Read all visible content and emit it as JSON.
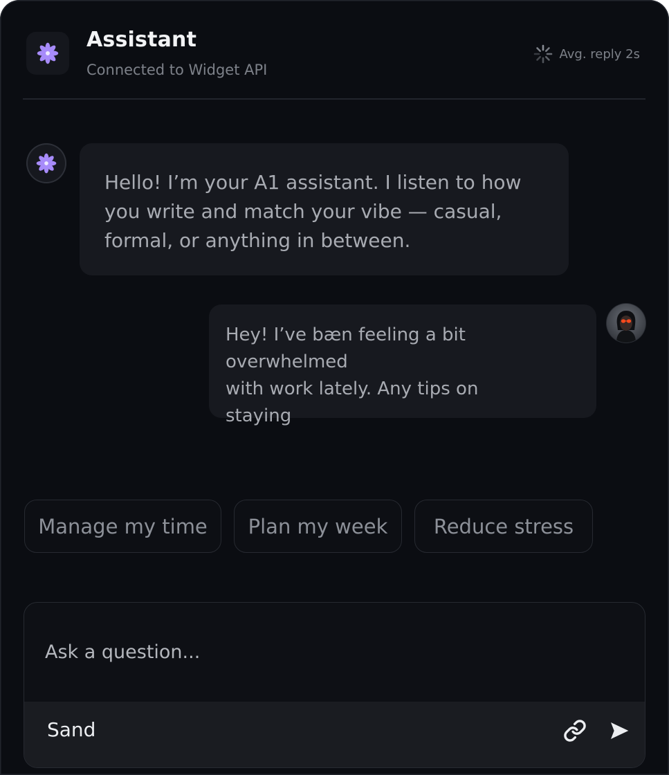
{
  "header": {
    "title": "Assistant",
    "subtitle": "Connected to Widget API",
    "reply_meta": "Avg. reply 2s",
    "logo_icon": "flower-icon",
    "accent": "#a78bfa"
  },
  "messages": [
    {
      "role": "assistant",
      "avatar_icon": "flower-icon",
      "text": "Hello! I’m your A1 assistant. I listen to how you write and match your vibe — casual, formal, or anything in between."
    },
    {
      "role": "user",
      "avatar_icon": "user-avatar",
      "lines": [
        "Hey! I’ve bæn feeling a bit overwhelmed",
        "with work lately. Any tips on",
        "staying"
      ]
    }
  ],
  "suggestions": [
    "Manage my time",
    "Plan my week",
    "Reduce stress"
  ],
  "composer": {
    "placeholder": "Ask a question...",
    "send_label": "Sand",
    "attach_icon": "link-icon",
    "send_icon": "send-icon"
  }
}
